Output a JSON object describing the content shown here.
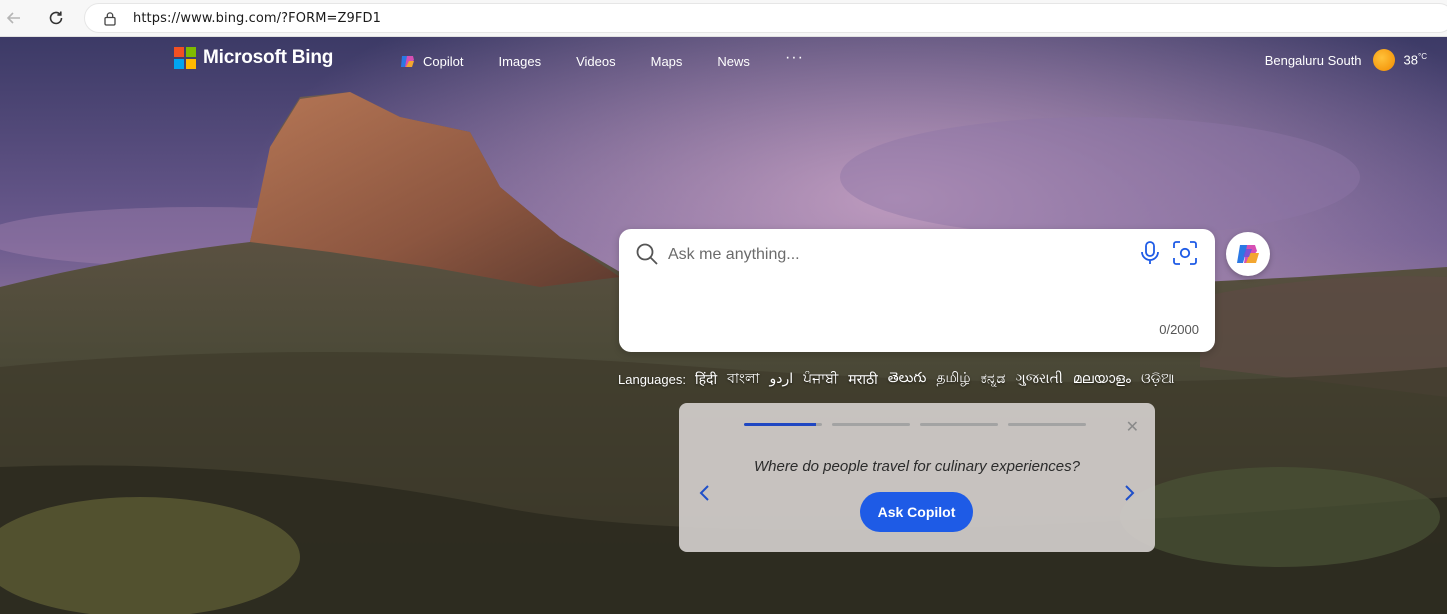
{
  "browser": {
    "url": "https://www.bing.com/?FORM=Z9FD1",
    "back_icon": "arrow-left-icon",
    "refresh_icon": "refresh-icon",
    "lock_icon": "lock-icon"
  },
  "header": {
    "brand": "Microsoft Bing",
    "nav": [
      {
        "label": "Copilot",
        "icon": "copilot-icon"
      },
      {
        "label": "Images"
      },
      {
        "label": "Videos"
      },
      {
        "label": "Maps"
      },
      {
        "label": "News"
      }
    ],
    "more": "···",
    "weather": {
      "location": "Bengaluru South",
      "temp": "38",
      "unit": "°C"
    }
  },
  "search": {
    "placeholder": "Ask me anything...",
    "value": "",
    "char_count": "0/2000",
    "icons": [
      "search-icon",
      "microphone-icon",
      "visual-search-icon"
    ]
  },
  "languages": {
    "label": "Languages:",
    "items": [
      "हिंदी",
      "বাংলা",
      "اردو",
      "ਪੰਜਾਬੀ",
      "मराठी",
      "తెలుగు",
      "தமிழ்",
      "ಕನ್ನಡ",
      "ગુજરાતી",
      "മലയാളം",
      "ଓଡ଼ିଆ"
    ]
  },
  "suggestion": {
    "question": "Where do people travel for culinary experiences?",
    "button": "Ask Copilot",
    "progress_steps": 4,
    "active_step": 1,
    "active_step_progress": 0.92
  },
  "colors": {
    "accent": "#1e5be6",
    "progress_active": "#1f47c2",
    "ms_logo": [
      "#f25022",
      "#7fba00",
      "#00a4ef",
      "#ffb900"
    ]
  }
}
